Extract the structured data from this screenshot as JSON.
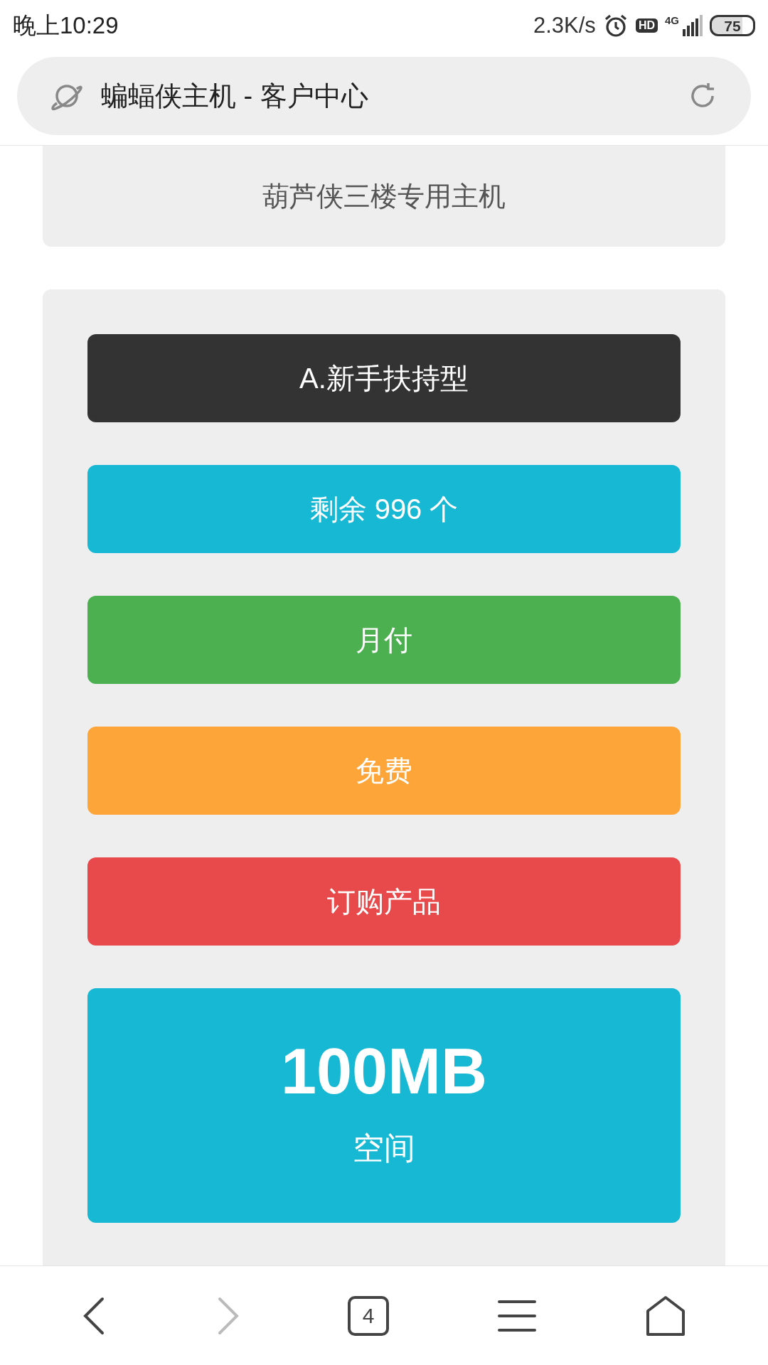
{
  "status_bar": {
    "time": "晚上10:29",
    "speed": "2.3K/s",
    "hd": "HD",
    "network": "4G",
    "battery": "75"
  },
  "address_bar": {
    "title": "蝙蝠侠主机 - 客户中心"
  },
  "intro_card": {
    "text": "葫芦侠三楼专用主机"
  },
  "plan_items": [
    {
      "kind": "bar",
      "label": "A.新手扶持型",
      "color": "#333333"
    },
    {
      "kind": "bar",
      "label": "剩余 996 个",
      "color": "#17b8d4"
    },
    {
      "kind": "bar",
      "label": "月付",
      "color": "#4caf50"
    },
    {
      "kind": "bar",
      "label": "免费",
      "color": "#fea53a"
    },
    {
      "kind": "bar",
      "label": "订购产品",
      "color": "#e84a4c"
    },
    {
      "kind": "feature",
      "value": "100MB",
      "caption": "空间",
      "color": "#17b8d4"
    }
  ],
  "bottom_nav": {
    "tab_count": "4",
    "forward_disabled": true
  }
}
